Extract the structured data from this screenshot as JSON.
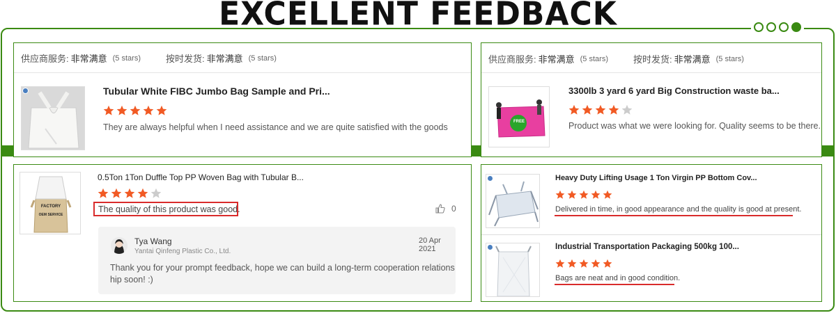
{
  "header": {
    "title": "EXCELLENT FEEDBACK"
  },
  "ratings": {
    "supplier_label": "供应商服务:",
    "supplier_value": "非常满意",
    "supplier_count": "(5 stars)",
    "delivery_label": "按时发货:",
    "delivery_value": "非常满意",
    "delivery_count": "(5 stars)"
  },
  "reviews": [
    {
      "title": "Tubular White FIBC Jumbo Bag Sample and Pri...",
      "stars": 5,
      "text": "They are always helpful when I need assistance and we are quite satisfied with the goods"
    },
    {
      "title": "3300lb 3 yard 6 yard Big Construction waste ba...",
      "stars": 4,
      "text": "Product was what we were looking for.  Quality seems to be there.",
      "thumb_label": "FREE"
    },
    {
      "title": "0.5Ton 1Ton Duffle Top PP Woven Bag with Tubular B...",
      "stars": 4,
      "text": "The quality of this product was good.",
      "likes": "0",
      "thumb_label_1": "FACTORY",
      "thumb_label_2": "OEM SERVICE",
      "reply": {
        "name": "Tya Wang",
        "company": "Yantai Qinfeng Plastic Co., Ltd.",
        "date": "20 Apr 2021",
        "message": "Thank you for your prompt feedback, hope we can build a long-term cooperation relationship soon! :)"
      }
    },
    {
      "title": "Heavy Duty Lifting Usage 1 Ton Virgin PP Bottom Cov...",
      "stars": 5,
      "text": "Delivered in time, in good appearance and the quality is good at present."
    },
    {
      "title": "Industrial Transportation Packaging 500kg 100...",
      "stars": 5,
      "text": "Bags are neat and in good condition."
    }
  ],
  "colors": {
    "accent": "#3a8a12",
    "star": "#f15a24",
    "star_empty": "#cccccc",
    "highlight": "#d92b2b"
  }
}
